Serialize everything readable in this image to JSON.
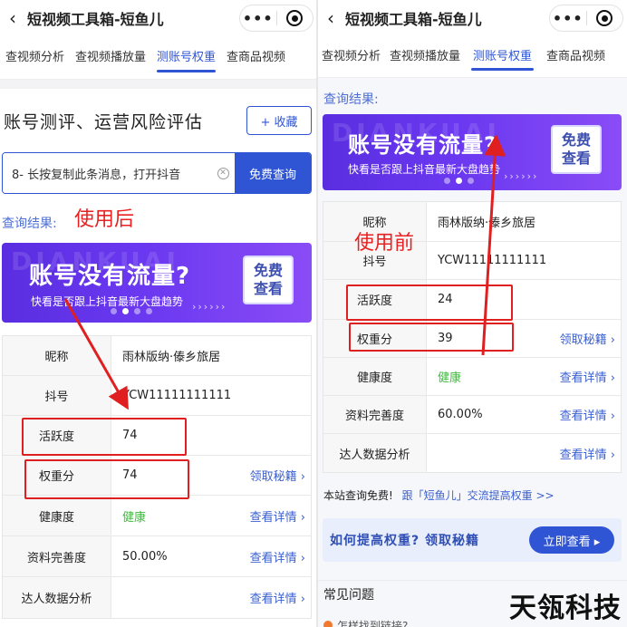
{
  "left": {
    "title": "短视频工具箱-短鱼儿",
    "back_icon": "‹",
    "more_icon": "•••",
    "tabs": [
      "查视频分析",
      "查视频播放量",
      "测账号权重",
      "查商品视频"
    ],
    "section_title": "账号测评、运营风险评估",
    "collect_label": "+ 收藏",
    "search_value": "8- 长按复制此条消息，打开抖音",
    "search_button": "免费查询",
    "result_label": "查询结果:",
    "annotation": "使用后",
    "banner": {
      "watermark": "DIANKUAI",
      "title": "账号没有流量?",
      "subtitle": "快看是否跟上抖音最新大盘趋势",
      "button": "免费\n查看"
    },
    "rows": [
      {
        "key": "昵称",
        "value": "雨林版纳·傣乡旅居",
        "link": ""
      },
      {
        "key": "抖号",
        "value": "YCW11111111111",
        "link": ""
      },
      {
        "key": "活跃度",
        "value": "74",
        "link": ""
      },
      {
        "key": "权重分",
        "value": "74",
        "link": "领取秘籍 ›"
      },
      {
        "key": "健康度",
        "value": "健康",
        "link": "查看详情 ›"
      },
      {
        "key": "资料完善度",
        "value": "50.00%",
        "link": "查看详情 ›"
      },
      {
        "key": "达人数据分析",
        "value": "",
        "link": "查看详情 ›"
      }
    ]
  },
  "right": {
    "title": "短视频工具箱-短鱼儿",
    "back_icon": "‹",
    "more_icon": "•••",
    "tabs": [
      "查视频分析",
      "查视频播放量",
      "测账号权重",
      "查商品视频"
    ],
    "result_label": "查询结果:",
    "annotation": "使用前",
    "banner": {
      "watermark": "DIANKUAI",
      "title": "账号没有流量?",
      "subtitle": "快看是否跟上抖音最新大盘趋势",
      "button": "免费\n查看"
    },
    "rows": [
      {
        "key": "昵称",
        "value": "雨林版纳·傣乡旅居",
        "link": ""
      },
      {
        "key": "抖号",
        "value": "YCW11111111111",
        "link": ""
      },
      {
        "key": "活跃度",
        "value": "24",
        "link": ""
      },
      {
        "key": "权重分",
        "value": "39",
        "link": "领取秘籍 ›"
      },
      {
        "key": "健康度",
        "value": "健康",
        "link": "查看详情 ›"
      },
      {
        "key": "资料完善度",
        "value": "60.00%",
        "link": "查看详情 ›"
      },
      {
        "key": "达人数据分析",
        "value": "",
        "link": "查看详情 ›"
      }
    ],
    "notice_text": "本站查询免费!",
    "notice_link": "跟「短鱼儿」交流提高权重 >>",
    "howto_text": "如何提高权重? 领取秘籍",
    "howto_button": "立即查看 ▸",
    "faq_title": "常见问题",
    "faq_first": "怎样找到链接?"
  },
  "brand": "天瓴科技",
  "colors": {
    "accent": "#2f55d4",
    "annotation": "#e02020",
    "healthy": "#3dbb3d"
  }
}
